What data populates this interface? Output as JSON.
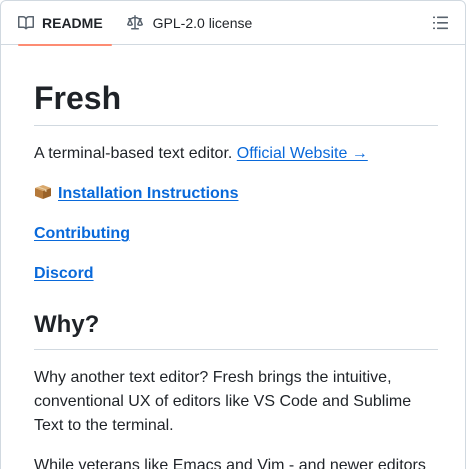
{
  "tabs": {
    "readme_label": "README",
    "license_label": "GPL-2.0 license"
  },
  "readme": {
    "title": "Fresh",
    "intro_text": "A terminal-based text editor. ",
    "website_link": "Official Website →",
    "install_link": "Installation Instructions",
    "contributing_link": "Contributing",
    "discord_link": "Discord",
    "why_heading": "Why?",
    "why_paragraph": "Why another text editor? Fresh brings the intuitive, conventional UX of editors like VS Code and Sublime Text to the terminal.",
    "while_paragraph": "While veterans like Emacs and Vim - and newer editors"
  },
  "colors": {
    "link": "#0969da",
    "active_tab_underline": "#fd8c73",
    "border": "#d1d9e0",
    "text": "#1f2328"
  },
  "icons": {
    "readme": "book-icon",
    "license": "scale-icon",
    "outline": "list-unordered-icon",
    "install": "package-icon"
  }
}
